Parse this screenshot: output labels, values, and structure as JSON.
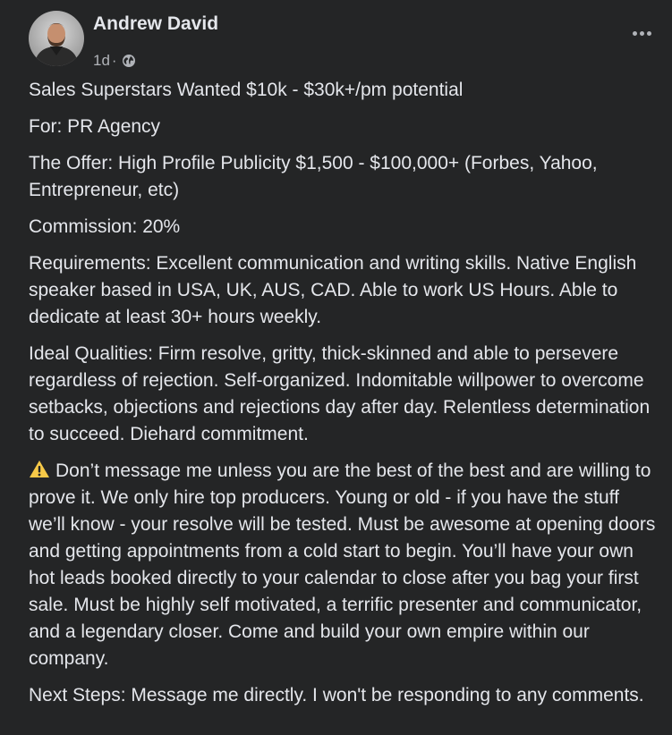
{
  "post": {
    "author": "Andrew David",
    "time": "1d",
    "separator": "·",
    "privacy_icon": "globe-icon",
    "more_icon": "more-dots-icon",
    "avatar_icon": "avatar",
    "paragraphs": [
      "Sales Superstars Wanted $10k - $30k+/pm potential",
      "For: PR Agency",
      "The Offer: High Profile Publicity $1,500 - $100,000+ (Forbes, Yahoo, Entrepreneur, etc)",
      "Commission: 20%",
      "Requirements: Excellent communication and writing skills. Native English speaker based in USA, UK, AUS, CAD. Able to work US Hours. Able to dedicate at least 30+ hours weekly.",
      "Ideal Qualities: Firm resolve, gritty, thick-skinned and able to persevere regardless of rejection. Self-organized. Indomitable willpower to overcome setbacks, objections and rejections day after day. Relentless determination to succeed. Diehard commitment.",
      "Don’t message me unless you are the best of the best and are willing to prove it. We only hire top producers. Young or old - if you have the stuff we’ll know - your resolve will be tested. Must be awesome at opening doors and getting appointments from a cold start to begin. You’ll have your own hot leads booked directly to your calendar to close after you bag your first sale. Must be highly self motivated, a terrific presenter and communicator, and a legendary closer. Come and build your own empire within our company.",
      "Next Steps: Message me directly. I won't be responding to any comments."
    ]
  },
  "colors": {
    "background": "#242526",
    "primary_text": "#e4e6eb",
    "secondary_text": "#b0b3b8",
    "warning": "#f7c948"
  }
}
